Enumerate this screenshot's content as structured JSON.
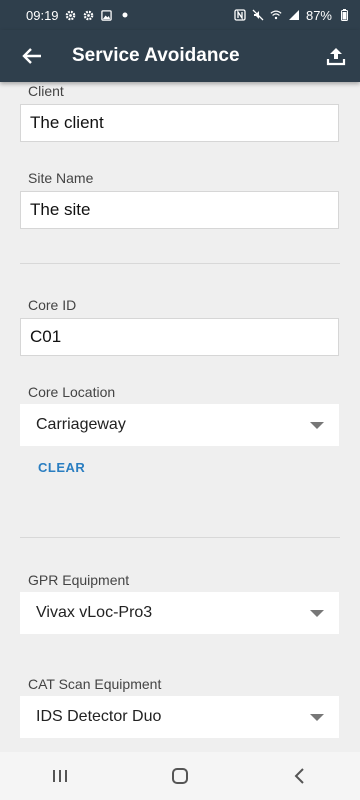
{
  "status_bar": {
    "time": "09:19",
    "battery_percent": "87%",
    "left_icons": [
      "gear-icon",
      "gear-icon",
      "image-icon",
      "dot-icon"
    ],
    "right_icons": [
      "nfc-icon",
      "mute-icon",
      "wifi-icon",
      "signal-icon",
      "battery-icon"
    ]
  },
  "app_bar": {
    "title": "Service Avoidance",
    "back_icon": "arrow-left-icon",
    "action_icon": "upload-icon"
  },
  "form": {
    "client_label": "Client",
    "client_value": "The client",
    "site_name_label": "Site Name",
    "site_name_value": "The site",
    "core_id_label": "Core ID",
    "core_id_value": "C01",
    "core_location_label": "Core Location",
    "core_location_value": "Carriageway",
    "clear_label": "CLEAR",
    "gpr_label": "GPR Equipment",
    "gpr_value": "Vivax vLoc-Pro3",
    "cat_label": "CAT Scan Equipment",
    "cat_value": "IDS Detector Duo"
  },
  "nav_bar": {
    "icons": [
      "recent-apps-icon",
      "home-icon",
      "back-icon"
    ]
  },
  "colors": {
    "app_bar": "#2f3f4c",
    "accent": "#2a7ec1",
    "background": "#efefef"
  }
}
